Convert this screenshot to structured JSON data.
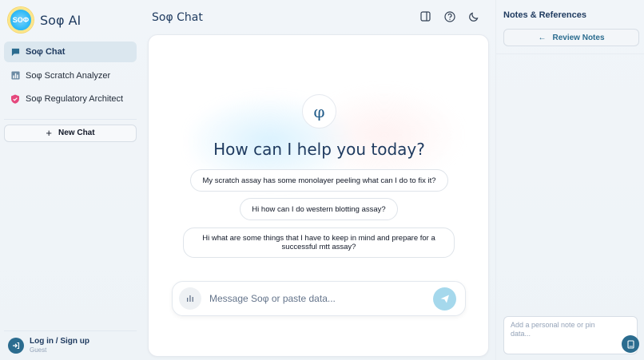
{
  "brand": {
    "logo_text": "SOΦ",
    "name": "Soφ AI"
  },
  "sidebar": {
    "items": [
      {
        "label": "Soφ Chat",
        "icon": "chat-bubble-icon",
        "active": true
      },
      {
        "label": "Soφ Scratch Analyzer",
        "icon": "bar-chart-icon",
        "active": false
      },
      {
        "label": "Soφ Regulatory Architect",
        "icon": "shield-icon",
        "active": false
      }
    ],
    "new_chat_label": "New Chat",
    "footer": {
      "login_label": "Log in / Sign up",
      "status": "Guest"
    }
  },
  "main": {
    "title": "Soφ Chat",
    "header_icons": [
      "panel-toggle-icon",
      "help-icon",
      "dark-mode-icon"
    ],
    "badge_symbol": "φ",
    "greeting": "How can I help you today?",
    "suggestions": [
      "My scratch assay has some monolayer peeling what can I do to fix it?",
      "Hi how can I do western blotting assay?",
      "Hi what are some things that I have to keep in mind and prepare for a successful mtt assay?"
    ],
    "composer": {
      "placeholder": "Message Soφ or paste data..."
    }
  },
  "notes": {
    "title": "Notes & References",
    "review_label": "Review Notes",
    "note_placeholder": "Add a personal note or pin data..."
  },
  "colors": {
    "accent": "#2b6c8f",
    "heading": "#1e3a5f",
    "active_nav_bg": "#dbe7ef",
    "send_button": "#a5d8ec",
    "shield_pink": "#e5487d"
  }
}
